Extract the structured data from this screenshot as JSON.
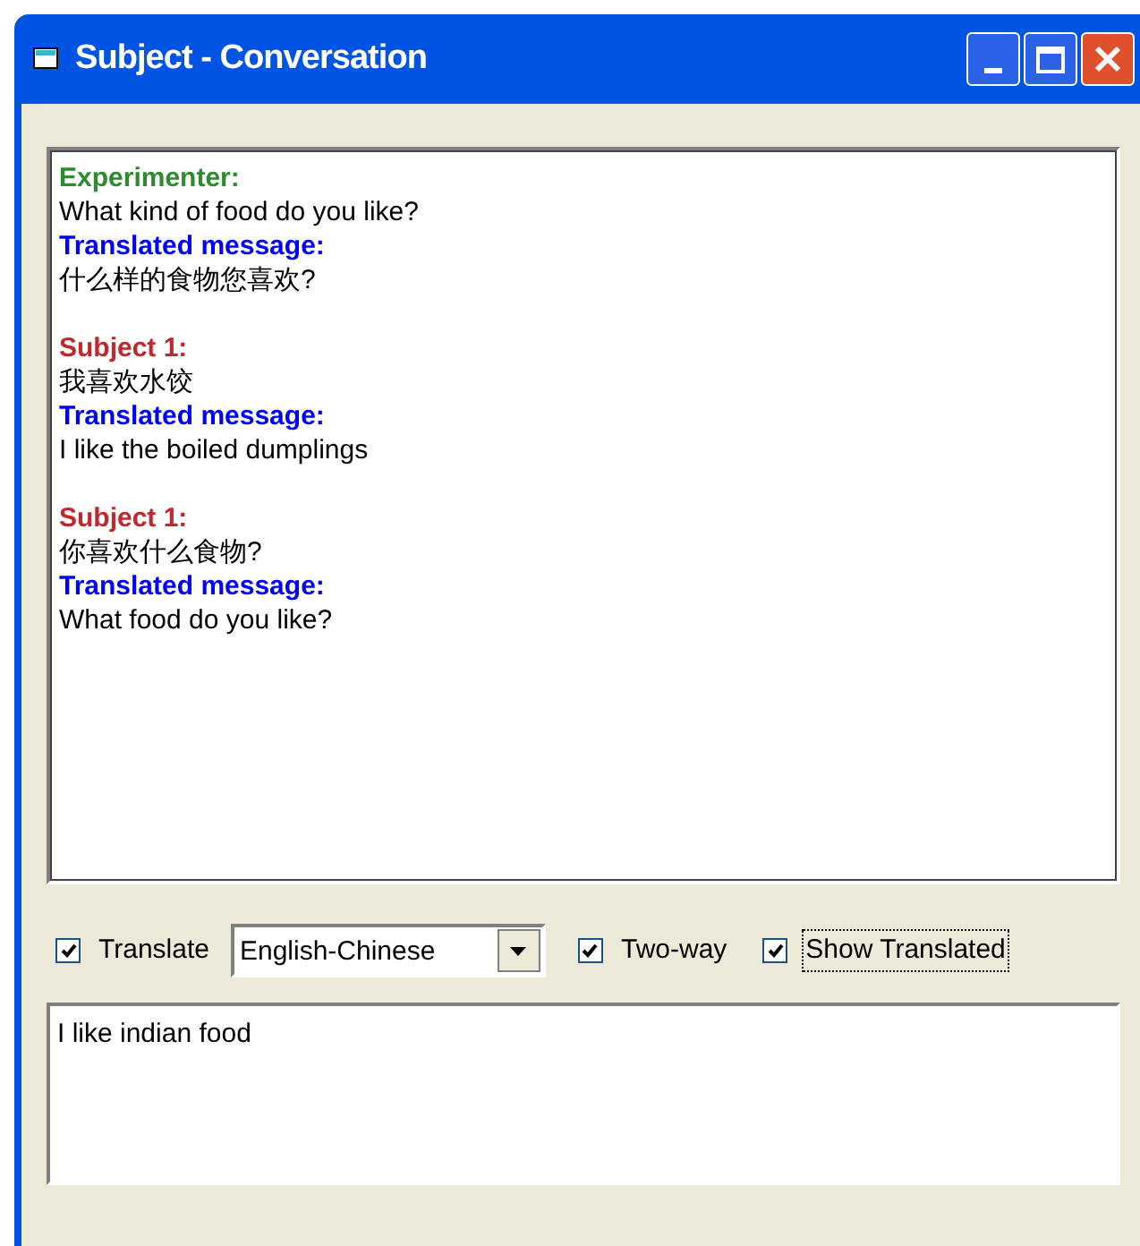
{
  "window": {
    "title": "Subject - Conversation"
  },
  "conversation": [
    {
      "speaker": "Experimenter:",
      "color": "#2e8b2e",
      "text": "What kind of food do you like?",
      "translation_label": "Translated message:",
      "translation": "什么样的食物您喜欢?"
    },
    {
      "speaker": "Subject 1:",
      "color": "#c0282d",
      "text": "我喜欢水饺",
      "translation_label": "Translated message:",
      "translation": "I like the boiled dumplings"
    },
    {
      "speaker": "Subject 1:",
      "color": "#c0282d",
      "text": "你喜欢什么食物?",
      "translation_label": "Translated message:",
      "translation": "What food do you like?"
    }
  ],
  "options": [
    {
      "kind": "checkbox",
      "label": "Translate",
      "checked": true,
      "focused": false
    },
    {
      "kind": "dropdown",
      "value": "English-Chinese"
    },
    {
      "kind": "checkbox",
      "label": "Two-way",
      "checked": true,
      "focused": false
    },
    {
      "kind": "checkbox",
      "label": "Show Translated",
      "checked": true,
      "focused": true
    }
  ],
  "message_input": {
    "value": "I like indian food"
  }
}
